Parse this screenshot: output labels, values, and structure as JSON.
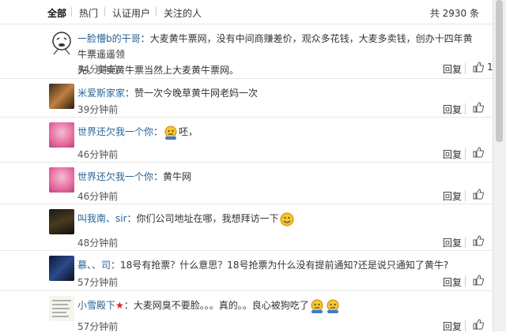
{
  "tabs": [
    "全部",
    "热门",
    "认证用户",
    "关注的人"
  ],
  "total": "共 2930 条",
  "reply_label": "回复",
  "comments": [
    {
      "user": "一脸懵b的干哥",
      "text_a": "：大麦黄牛票网，没有中间商赚差价，观众多花钱，大麦多卖钱，创办十四年黄牛票遥遥领",
      "text_b": "先。买卖黄牛票当然上大麦黄牛票网。",
      "time": "34分钟前",
      "likes": "1"
    },
    {
      "user": "米爱斯家家",
      "text_a": "：赞一次今晚草黄牛网老妈一次",
      "text_b": "",
      "time": "39分钟前",
      "likes": ""
    },
    {
      "user": "世界还欠我一个你",
      "text_a": "：",
      "text_b": "呸，",
      "time": "46分钟前",
      "likes": ""
    },
    {
      "user": "世界还欠我一个你",
      "text_a": "：黄牛网",
      "text_b": "",
      "time": "46分钟前",
      "likes": ""
    },
    {
      "user": "叫我南、sir",
      "text_a": "：你们公司地址在哪，我想拜访一下",
      "text_b": "",
      "time": "48分钟前",
      "likes": ""
    },
    {
      "user": "慕、、司",
      "text_a": "：18号有抢票？什么意思？18号抢票为什么没有提前通知?还是说只通知了黄牛?",
      "text_b": "",
      "time": "57分钟前",
      "likes": ""
    },
    {
      "user": "小雪殿下",
      "text_a": "：大麦网臭不要脸。。。真的。。良心被狗吃了",
      "text_b": "",
      "time": "57分钟前",
      "likes": ""
    }
  ]
}
